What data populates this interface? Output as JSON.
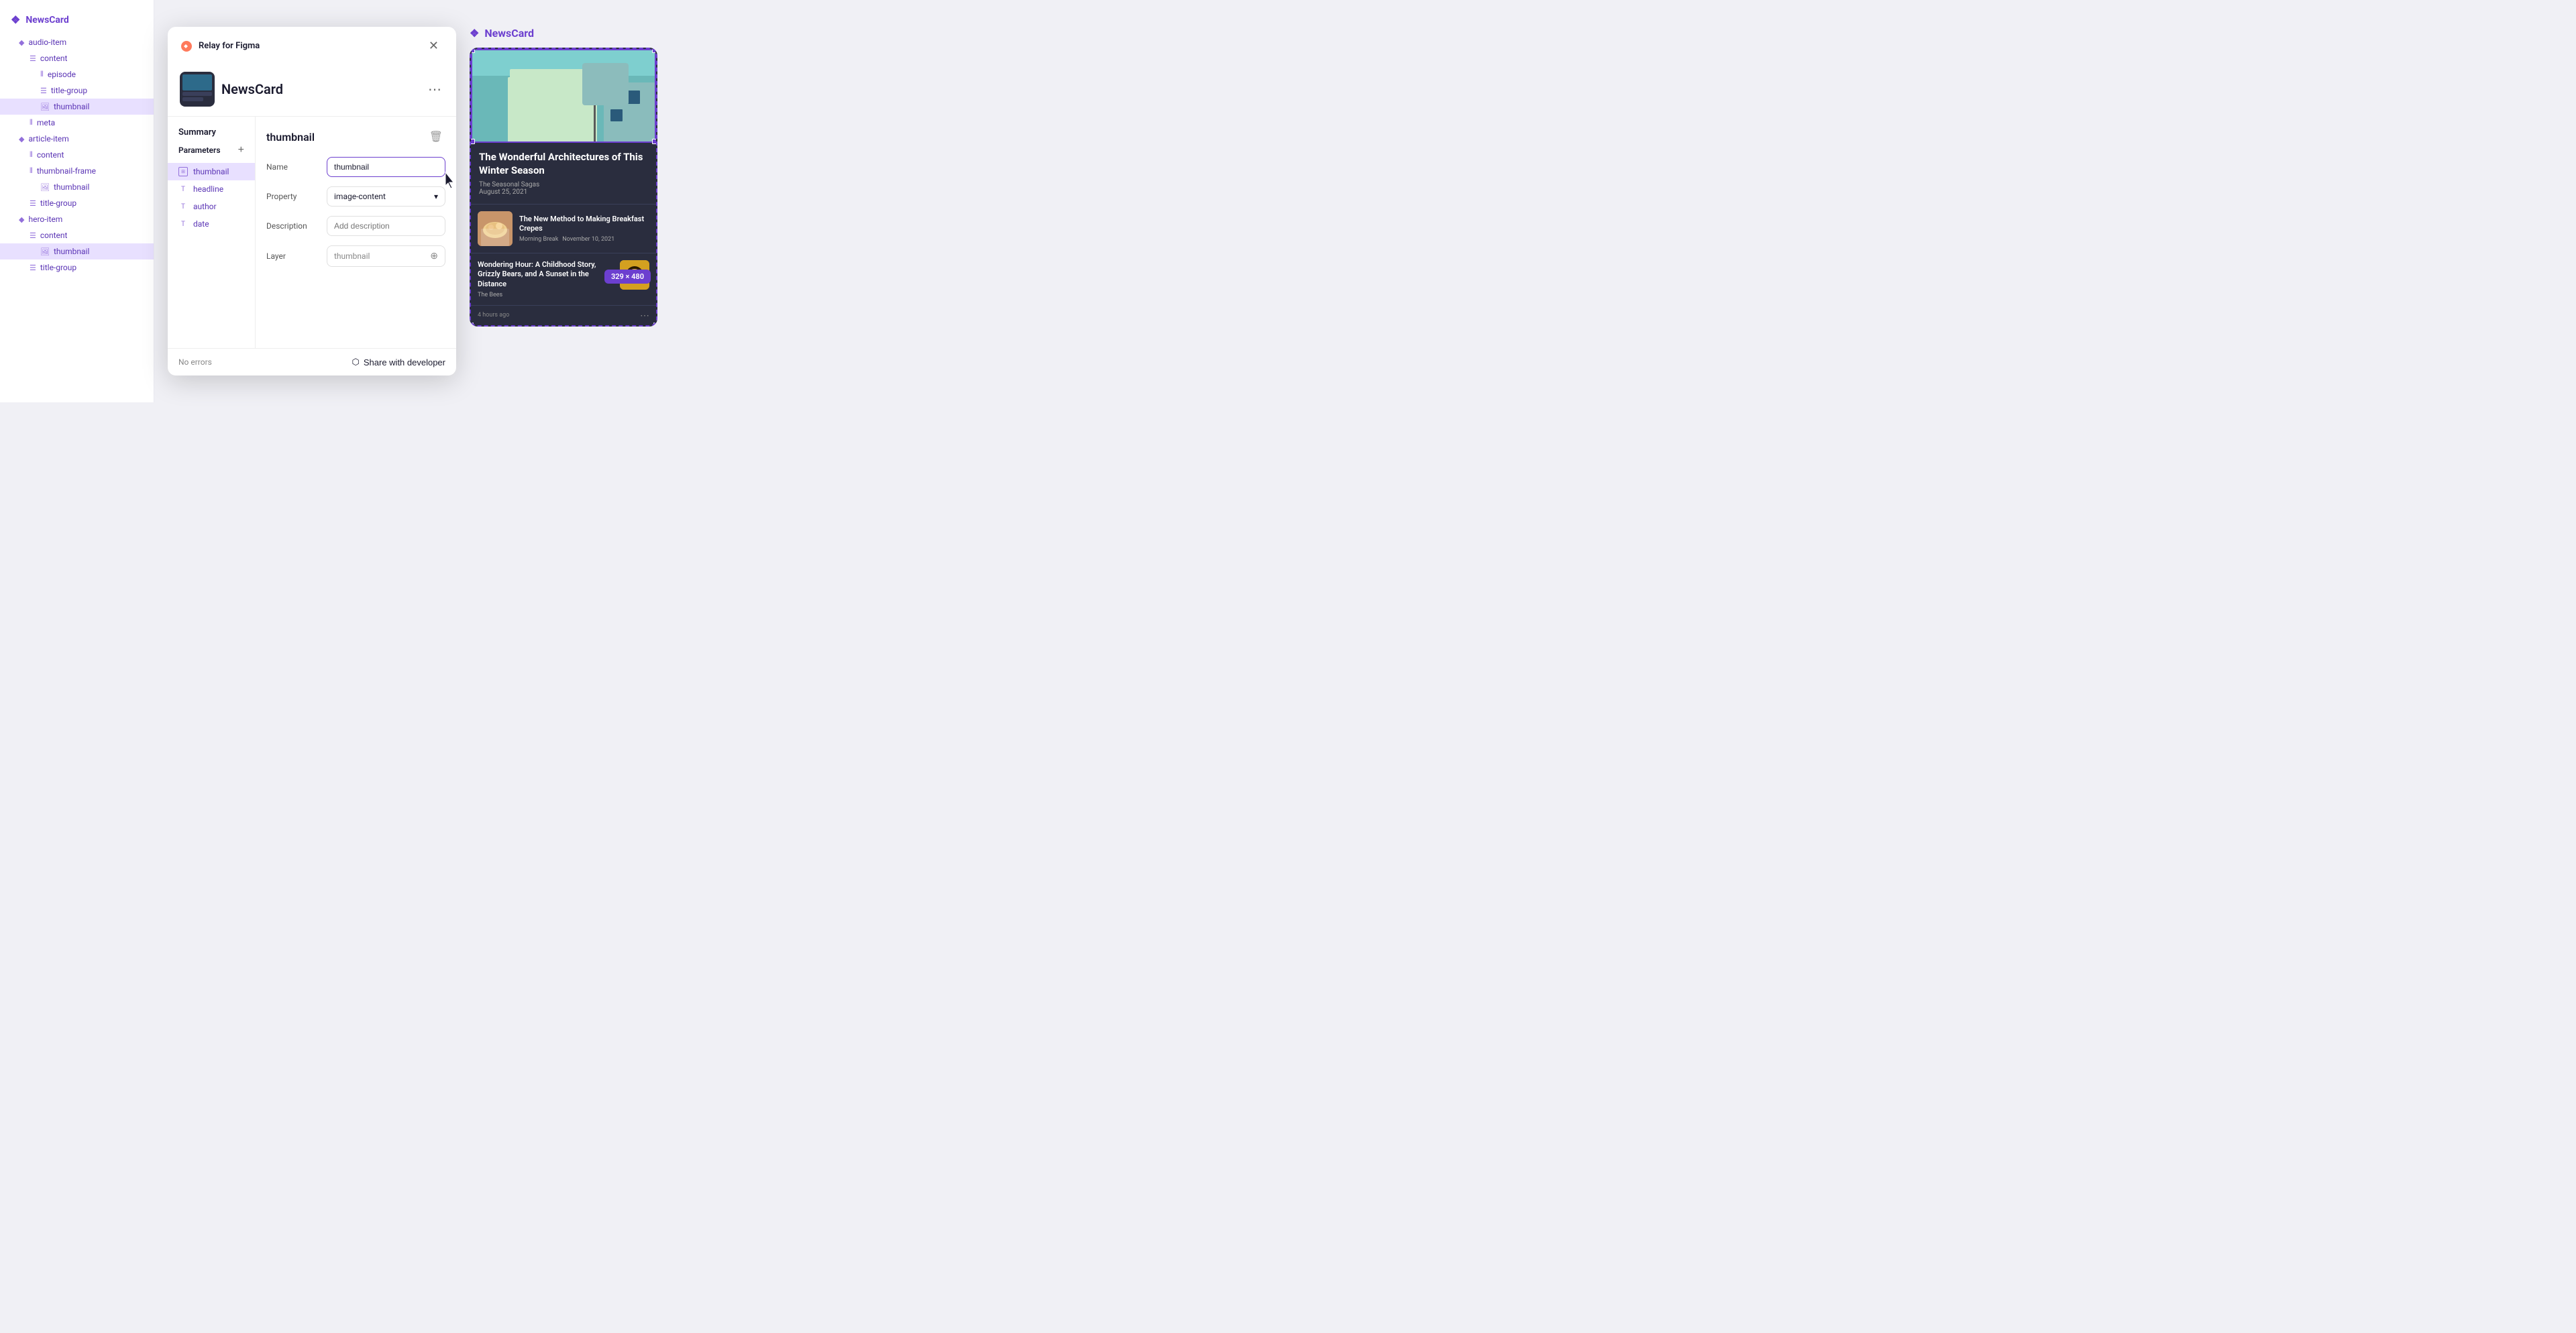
{
  "app": {
    "title": "NewsCard",
    "preview_title": "NewsCard"
  },
  "sidebar": {
    "title": "NewsCard",
    "items": [
      {
        "id": "audio-item",
        "label": "audio-item",
        "icon": "diamond",
        "indent": 1
      },
      {
        "id": "content",
        "label": "content",
        "icon": "lines",
        "indent": 2
      },
      {
        "id": "episode",
        "label": "episode",
        "icon": "bars",
        "indent": 3
      },
      {
        "id": "title-group",
        "label": "title-group",
        "icon": "lines",
        "indent": 3
      },
      {
        "id": "thumbnail",
        "label": "thumbnail",
        "icon": "image",
        "indent": 3,
        "active": true
      },
      {
        "id": "meta",
        "label": "meta",
        "icon": "bars",
        "indent": 2
      },
      {
        "id": "article-item",
        "label": "article-item",
        "icon": "diamond",
        "indent": 1
      },
      {
        "id": "content2",
        "label": "content",
        "icon": "bars",
        "indent": 2
      },
      {
        "id": "thumbnail-frame",
        "label": "thumbnail-frame",
        "icon": "bars",
        "indent": 2
      },
      {
        "id": "thumbnail2",
        "label": "thumbnail",
        "icon": "image",
        "indent": 3
      },
      {
        "id": "title-group2",
        "label": "title-group",
        "icon": "lines",
        "indent": 2
      },
      {
        "id": "hero-item",
        "label": "hero-item",
        "icon": "diamond",
        "indent": 1
      },
      {
        "id": "content3",
        "label": "content",
        "icon": "lines",
        "indent": 2
      },
      {
        "id": "thumbnail3",
        "label": "thumbnail",
        "icon": "image",
        "indent": 3,
        "active2": true
      },
      {
        "id": "title-group3",
        "label": "title-group",
        "icon": "lines",
        "indent": 2
      }
    ]
  },
  "modal": {
    "header": {
      "title": "NewsCard",
      "more_label": "⋯",
      "close_label": "✕"
    },
    "summary_label": "Summary",
    "parameters_label": "Parameters",
    "add_label": "+",
    "params": [
      {
        "id": "thumbnail",
        "label": "thumbnail",
        "icon": "image",
        "active": true
      },
      {
        "id": "headline",
        "label": "headline",
        "icon": "T"
      },
      {
        "id": "author",
        "label": "author",
        "icon": "T"
      },
      {
        "id": "date",
        "label": "date",
        "icon": "T"
      }
    ],
    "detail": {
      "title": "thumbnail",
      "delete_label": "🗑",
      "fields": {
        "name_label": "Name",
        "name_value": "thumbnail",
        "property_label": "Property",
        "property_value": "image-content",
        "description_label": "Description",
        "description_placeholder": "Add description",
        "layer_label": "Layer",
        "layer_value": "thumbnail"
      }
    },
    "footer": {
      "no_errors_label": "No errors",
      "share_label": "Share with developer"
    }
  },
  "preview": {
    "title": "NewsCard",
    "card1": {
      "title": "The Wonderful Architectures of This Winter Season",
      "source": "The Seasonal Sagas",
      "date": "August 25, 2021"
    },
    "card2": {
      "title": "The New Method to Making Breakfast Crepes",
      "source": "Morning Break",
      "date": "November 10, 2021"
    },
    "card3": {
      "title": "Wondering Hour: A Childhood Story, Grizzly Bears, and A Sunset in the Distance",
      "source": "The Bees",
      "time_ago": "4 hours ago"
    },
    "dimensions": "329 × 480"
  }
}
